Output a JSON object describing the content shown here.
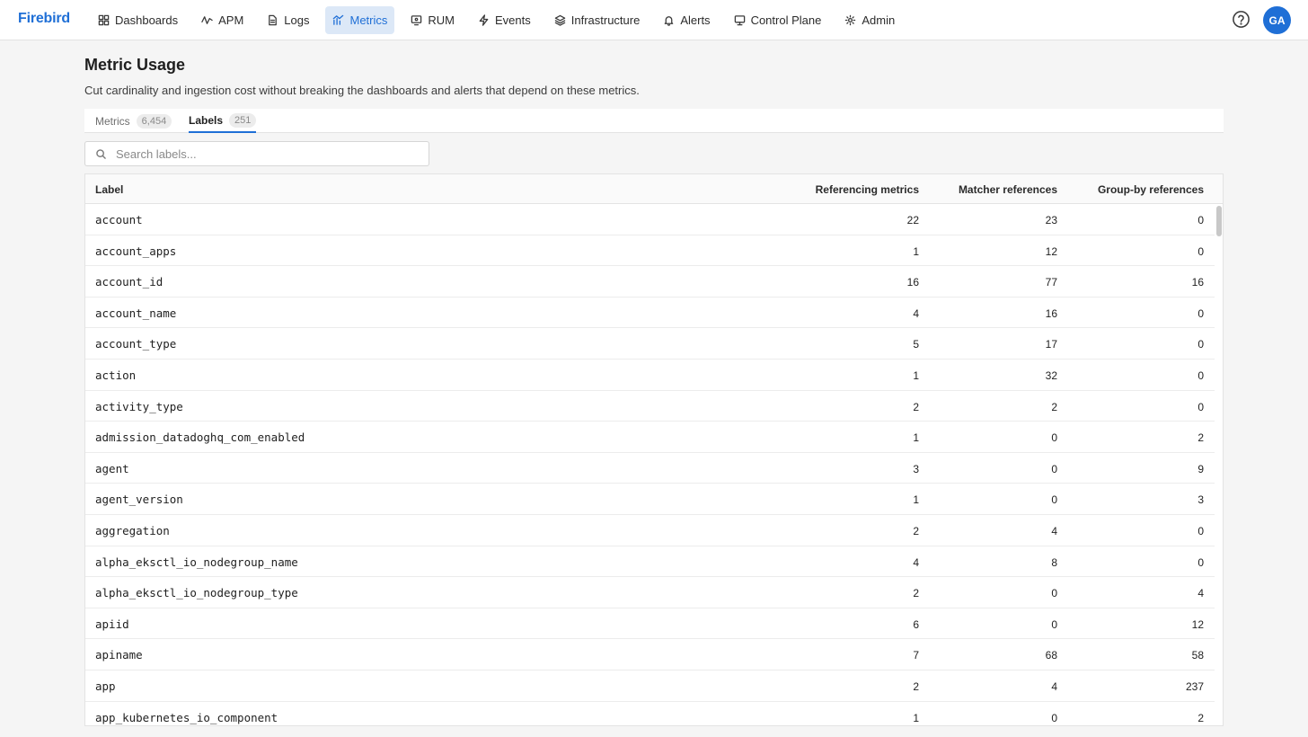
{
  "brand": "Firebird",
  "nav": [
    {
      "label": "Dashboards",
      "icon": "grid-icon",
      "active": false
    },
    {
      "label": "APM",
      "icon": "pulse-icon",
      "active": false
    },
    {
      "label": "Logs",
      "icon": "document-icon",
      "active": false
    },
    {
      "label": "Metrics",
      "icon": "line-chart-icon",
      "active": true
    },
    {
      "label": "RUM",
      "icon": "monitor-icon",
      "active": false
    },
    {
      "label": "Events",
      "icon": "lightning-icon",
      "active": false
    },
    {
      "label": "Infrastructure",
      "icon": "layers-icon",
      "active": false
    },
    {
      "label": "Alerts",
      "icon": "bell-icon",
      "active": false
    },
    {
      "label": "Control Plane",
      "icon": "desktop-icon",
      "active": false
    },
    {
      "label": "Admin",
      "icon": "gear-icon",
      "active": false
    }
  ],
  "user": {
    "initials": "GA"
  },
  "page": {
    "title": "Metric Usage",
    "description": "Cut cardinality and ingestion cost without breaking the dashboards and alerts that depend on these metrics."
  },
  "tabs": [
    {
      "label": "Metrics",
      "count": "6,454"
    },
    {
      "label": "Labels",
      "count": "251"
    }
  ],
  "search": {
    "placeholder": "Search labels...",
    "value": ""
  },
  "table": {
    "columns": [
      "Label",
      "Referencing metrics",
      "Matcher references",
      "Group-by references"
    ],
    "rows": [
      {
        "label": "account",
        "referencing": "22",
        "matcher": "23",
        "groupby": "0"
      },
      {
        "label": "account_apps",
        "referencing": "1",
        "matcher": "12",
        "groupby": "0"
      },
      {
        "label": "account_id",
        "referencing": "16",
        "matcher": "77",
        "groupby": "16"
      },
      {
        "label": "account_name",
        "referencing": "4",
        "matcher": "16",
        "groupby": "0"
      },
      {
        "label": "account_type",
        "referencing": "5",
        "matcher": "17",
        "groupby": "0"
      },
      {
        "label": "action",
        "referencing": "1",
        "matcher": "32",
        "groupby": "0"
      },
      {
        "label": "activity_type",
        "referencing": "2",
        "matcher": "2",
        "groupby": "0"
      },
      {
        "label": "admission_datadoghq_com_enabled",
        "referencing": "1",
        "matcher": "0",
        "groupby": "2"
      },
      {
        "label": "agent",
        "referencing": "3",
        "matcher": "0",
        "groupby": "9"
      },
      {
        "label": "agent_version",
        "referencing": "1",
        "matcher": "0",
        "groupby": "3"
      },
      {
        "label": "aggregation",
        "referencing": "2",
        "matcher": "4",
        "groupby": "0"
      },
      {
        "label": "alpha_eksctl_io_nodegroup_name",
        "referencing": "4",
        "matcher": "8",
        "groupby": "0"
      },
      {
        "label": "alpha_eksctl_io_nodegroup_type",
        "referencing": "2",
        "matcher": "0",
        "groupby": "4"
      },
      {
        "label": "apiid",
        "referencing": "6",
        "matcher": "0",
        "groupby": "12"
      },
      {
        "label": "apiname",
        "referencing": "7",
        "matcher": "68",
        "groupby": "58"
      },
      {
        "label": "app",
        "referencing": "2",
        "matcher": "4",
        "groupby": "237"
      },
      {
        "label": "app_kubernetes_io_component",
        "referencing": "1",
        "matcher": "0",
        "groupby": "2"
      }
    ]
  }
}
